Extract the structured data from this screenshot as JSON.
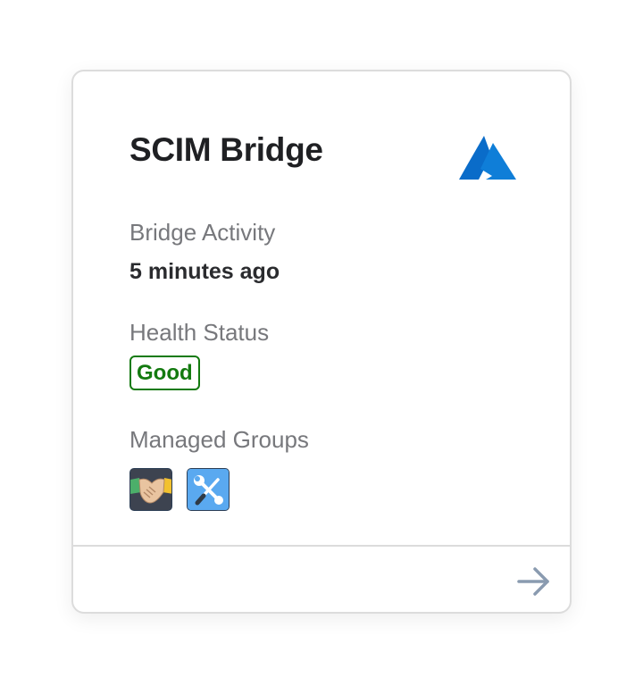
{
  "card": {
    "title": "SCIM Bridge",
    "provider_icon": "azure-logo",
    "activity": {
      "label": "Bridge Activity",
      "value": "5 minutes ago"
    },
    "health": {
      "label": "Health Status",
      "value": "Good",
      "color": "#137a0f"
    },
    "groups": {
      "label": "Managed Groups",
      "items": [
        {
          "icon": "handshake-icon",
          "background": "#3d4350"
        },
        {
          "icon": "wrench-screwdriver-icon",
          "background": "#5aa9f0"
        }
      ]
    },
    "footer": {
      "icon": "arrow-right-icon"
    }
  },
  "colors": {
    "azure_blue": "#0a6cc9",
    "arrow_gray": "#8a9bb0"
  }
}
